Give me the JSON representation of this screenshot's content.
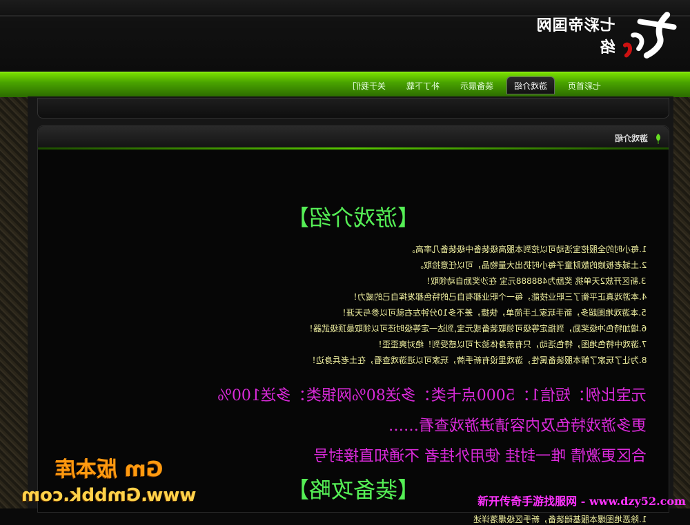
{
  "site": {
    "logo_text": "七彩帝国网络"
  },
  "nav": {
    "items": [
      {
        "label": "七彩首页",
        "active": false
      },
      {
        "label": "游戏介绍",
        "active": true
      },
      {
        "label": "装备展示",
        "active": false
      },
      {
        "label": "补丁下载",
        "active": false
      },
      {
        "label": "关于我们",
        "active": false
      }
    ]
  },
  "panel": {
    "title": "游戏介绍"
  },
  "content": {
    "heading1": "【游戏介绍】",
    "items": [
      "1.每小时的全服挖宝活动可以挖到本服高级装备中级装备几率高。",
      "2.土城老板娘的散财童子每小时扔出大量物品，可以任意捡取。",
      "3.新区开放2天单挑 奖励为488888元宝 在沙奖励自动领取！",
      "4.本游戏真正平衡了三职业技能，每一个职业都有自己的特色都发挥自己的威力！",
      "5.本游戏地图超多，新手玩家上手简单，快捷，差不多10分钟左右就可以参与天涯！",
      "6.增加特色冲级奖励，到指定等级可领取装备或元宝,到达一定等级时还可以领取最顶级武器！",
      "7.游戏中特色地图，特色活动，只有亲身体验才可以感受到！绝对爽歪歪！",
      "8.为让了玩家了解本服装备属性，游戏里设有新手牌，玩家可以进游戏查看，在土老兵身边！"
    ],
    "promo": [
      "元宝比例：短信1：5000点卡类：多送80%网银类：多送100%",
      "更多游戏特色及内容请进游戏查看……",
      "合区更激情 唯一封挂 使用外挂者 不通知直接封号"
    ],
    "heading2": "【装备攻略】",
    "items2": [
      "1.除恶地图爆本服基础装备，新手区级爆落详述"
    ]
  },
  "watermarks": {
    "left_line1": "Gm 版本库",
    "left_line2": "www.Gmbbk.com",
    "right": "新开传奇手游找服网 - www.dzy52.com"
  },
  "colors": {
    "nav_green": "#4aa400",
    "list_text": "#f0f0a0",
    "promo_pink": "#d92ad9",
    "heading_green": "#55ee55"
  }
}
